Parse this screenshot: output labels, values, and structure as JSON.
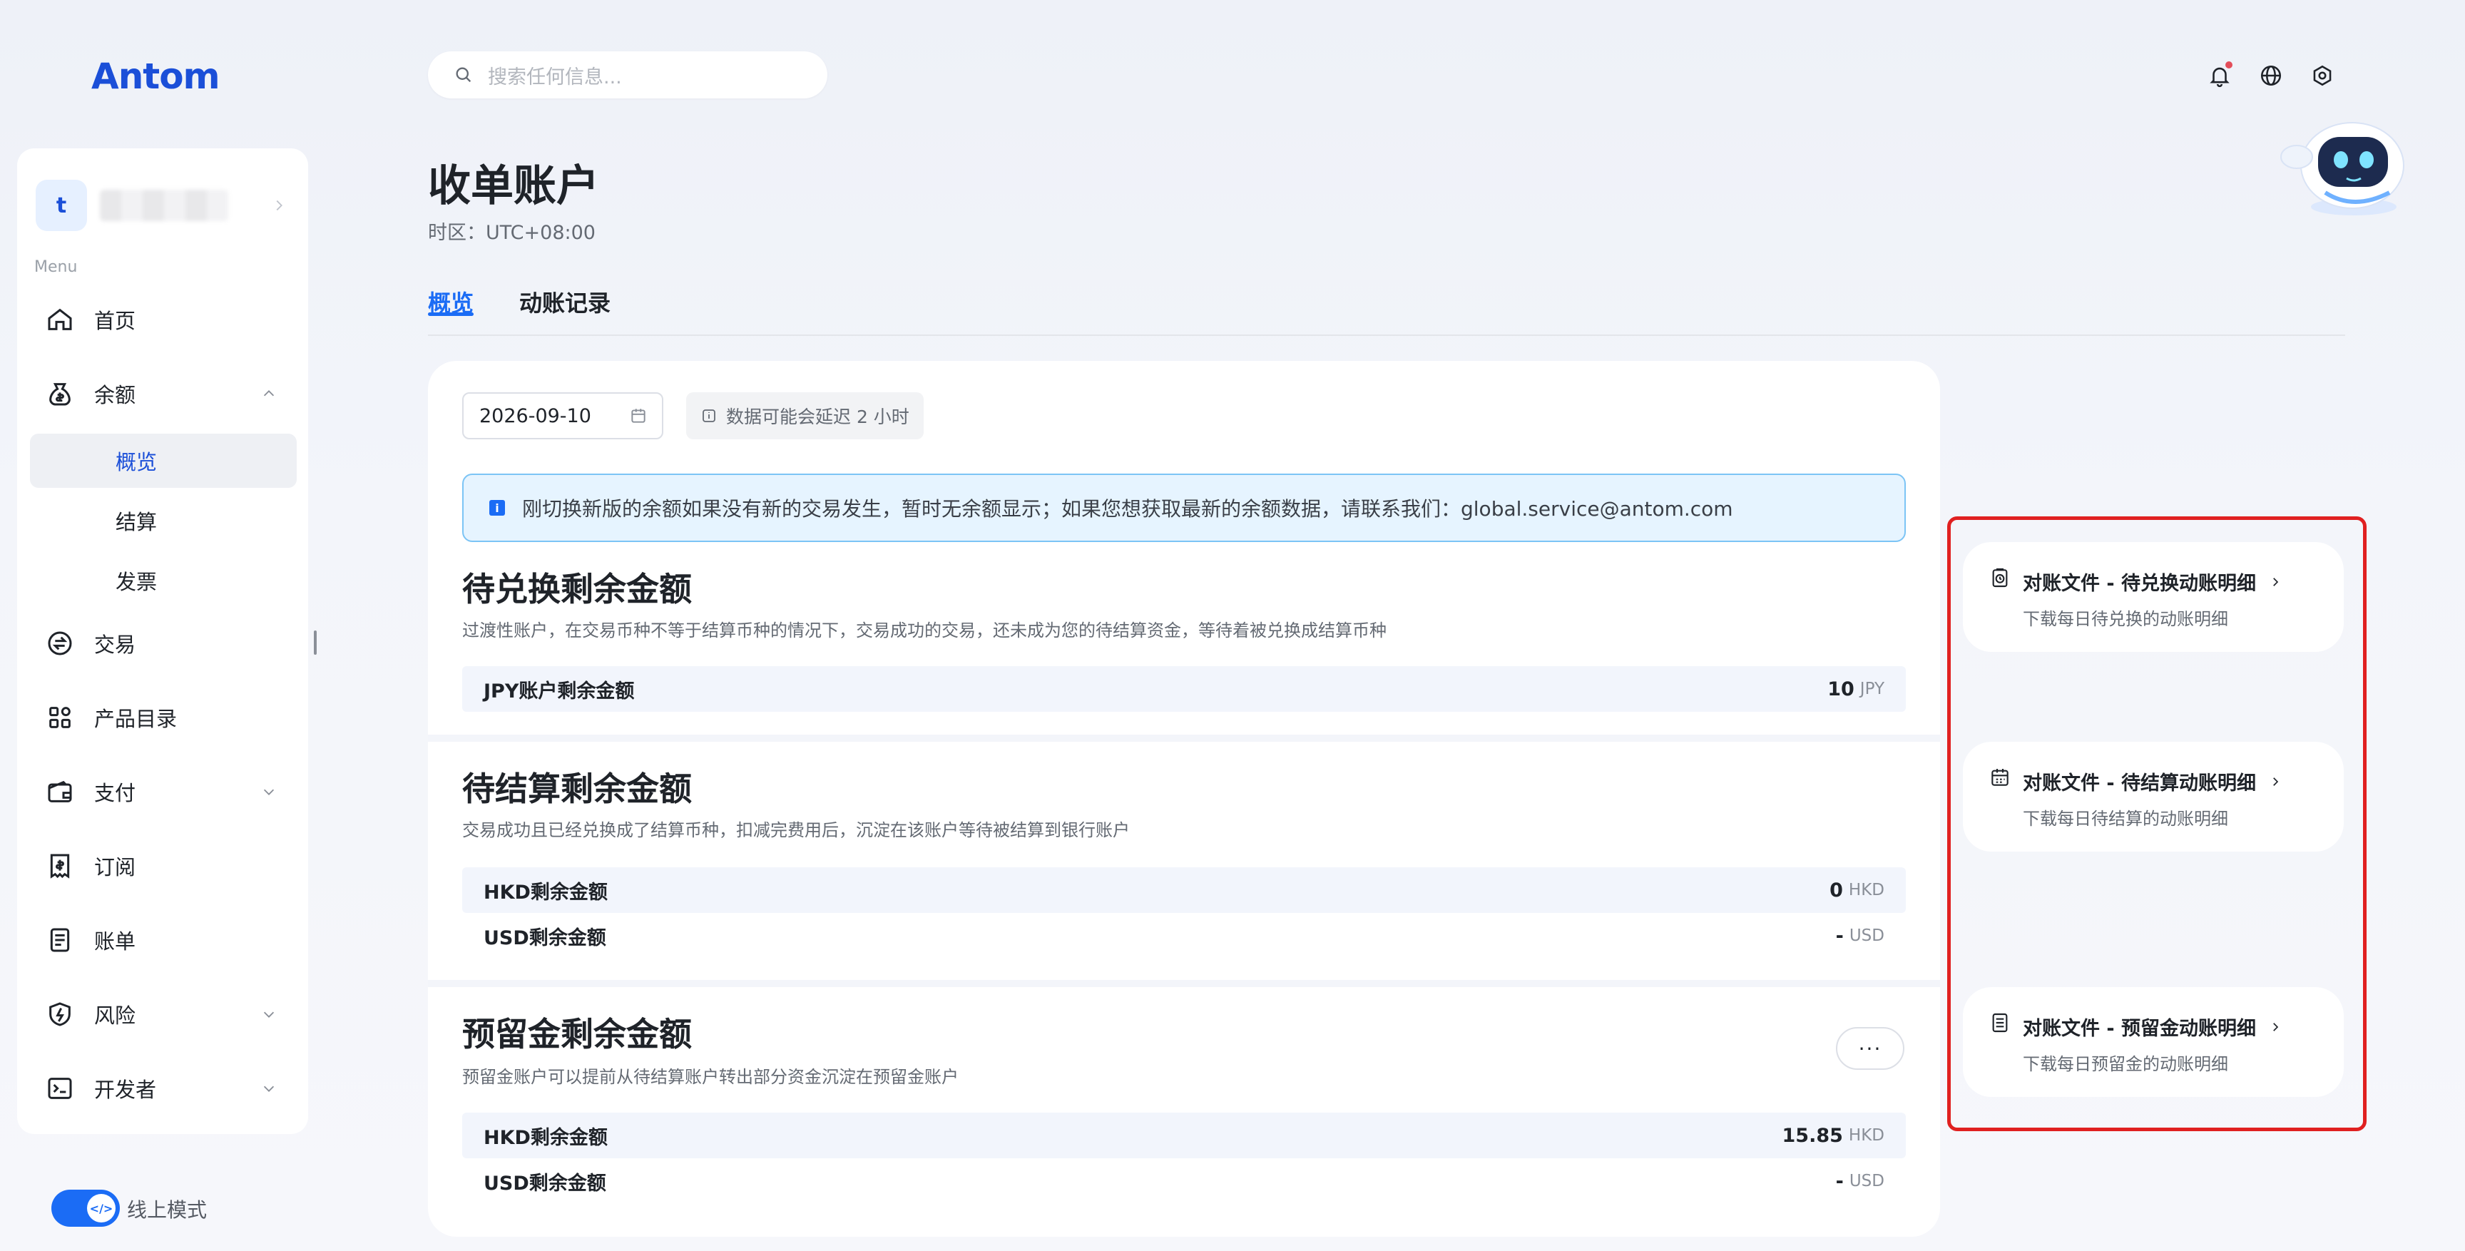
{
  "logo": "Antom",
  "search": {
    "placeholder": "搜索任何信息..."
  },
  "top_icons": [
    "bell-icon",
    "globe-icon",
    "settings-icon"
  ],
  "sidebar": {
    "account_initial": "t",
    "menu_label": "Menu",
    "items": [
      {
        "label": "首页",
        "icon": "home-icon"
      },
      {
        "label": "余额",
        "icon": "balance-icon",
        "expanded": true,
        "children": [
          {
            "label": "概览",
            "active": true
          },
          {
            "label": "结算"
          },
          {
            "label": "发票"
          }
        ]
      },
      {
        "label": "交易",
        "icon": "exchange-icon"
      },
      {
        "label": "产品目录",
        "icon": "grid-icon"
      },
      {
        "label": "支付",
        "icon": "wallet-icon",
        "expandable": true
      },
      {
        "label": "订阅",
        "icon": "subscription-icon"
      },
      {
        "label": "账单",
        "icon": "bill-icon"
      },
      {
        "label": "风险",
        "icon": "shield-icon",
        "expandable": true
      },
      {
        "label": "开发者",
        "icon": "terminal-icon",
        "expandable": true
      }
    ],
    "mode_label": "线上模式",
    "mode_on": true
  },
  "page": {
    "title": "收单账户",
    "timezone": "时区：UTC+08:00",
    "tabs": [
      {
        "label": "概览",
        "active": true
      },
      {
        "label": "动账记录"
      }
    ]
  },
  "panel": {
    "date": "2026-09-10",
    "delay_note": "数据可能会延迟 2 小时",
    "notice": "刚切换新版的余额如果没有新的交易发生，暂时无余额显示；如果您想获取最新的余额数据，请联系我们：global.service@antom.com",
    "sections": [
      {
        "title": "待兑换剩余金额",
        "desc": "过渡性账户，在交易币种不等于结算币种的情况下，交易成功的交易，还未成为您的待结算资金，等待着被兑换成结算币种",
        "rows": [
          {
            "label": "JPY账户剩余金额",
            "amount": "10",
            "currency": "JPY"
          }
        ]
      },
      {
        "title": "待结算剩余金额",
        "desc": "交易成功且已经兑换成了结算币种，扣减完费用后，沉淀在该账户等待被结算到银行账户",
        "rows": [
          {
            "label": "HKD剩余金额",
            "amount": "0",
            "currency": "HKD"
          },
          {
            "label": "USD剩余金额",
            "amount": "-",
            "currency": "USD"
          }
        ]
      },
      {
        "title": "预留金剩余金额",
        "desc": "预留金账户可以提前从待结算账户转出部分资金沉淀在预留金账户",
        "more": "···",
        "rows": [
          {
            "label": "HKD剩余金额",
            "amount": "15.85",
            "currency": "HKD"
          },
          {
            "label": "USD剩余金额",
            "amount": "-",
            "currency": "USD"
          }
        ]
      }
    ]
  },
  "right_cards": [
    {
      "title": "对账文件 - 待兑换动账明细",
      "desc": "下载每日待兑换的动账明细",
      "icon": "clipboard-clock-icon"
    },
    {
      "title": "对账文件 - 待结算动账明细",
      "desc": "下载每日待结算的动账明细",
      "icon": "calendar-icon"
    },
    {
      "title": "对账文件 - 预留金动账明细",
      "desc": "下载每日预留金的动账明细",
      "icon": "document-icon"
    }
  ],
  "colors": {
    "accent": "#1b6cf5",
    "highlight": "#e02020"
  }
}
